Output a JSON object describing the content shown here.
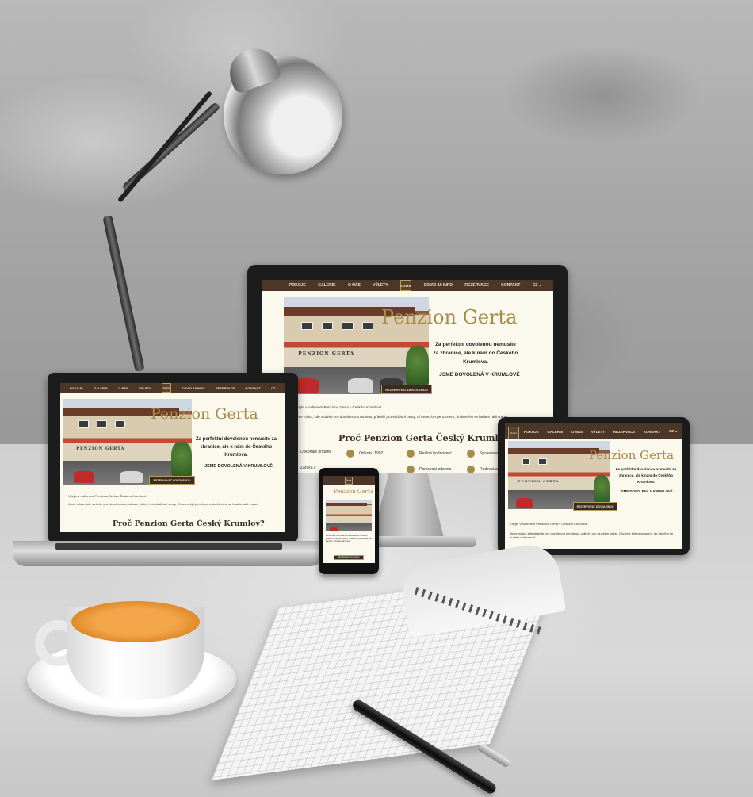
{
  "site": {
    "nav": [
      "POKOJE",
      "GALERIE",
      "O NÁS",
      "VÝLETY",
      "COVID-19 INFO",
      "REZERVACE",
      "KONTAKT"
    ],
    "nav_short": [
      "POKOJE",
      "GALERIE",
      "O NÁS",
      "VÝLETY",
      "REZERVACE",
      "KONTAKT"
    ],
    "lang": "CZ ⌄",
    "logo_text": "Gerta",
    "title": "Penzion Gerta",
    "tagline": "Za perfektní dovolenou nemusíte za zhranice, ale k nám do Českého Krumlova.",
    "subtitle": "JSME DOVOLENÁ V KRUMLOVĚ",
    "cta": "REZERVOVAT DOVOLENOU",
    "sign": "PENZION GERTA",
    "intro": "Vítejte v rodinném Penzionu Gerta v Českém Krumlově.",
    "body": "Jsme místo, kde strávíte pro dovolenou s rodinou, přáteli i pro služební cesty. Chceme být penzionem, do kterého se budete rádi vracet.",
    "section_title": "Proč Penzion Gerta Český Krumlov?",
    "features": [
      "Dokonalé přidané",
      "Od roku 1992",
      "Reálná hodnocení",
      "Společenská",
      "Záruka s",
      "Parkovací zdarma",
      "Rodinná am"
    ]
  },
  "colors": {
    "nav_bg": "#4b3628",
    "accent_gold": "#a88b46",
    "page_bg": "#fbf8ee"
  },
  "icons": [
    "desk-lamp-icon",
    "coffee-cup-icon",
    "notebook-icon",
    "pen-icon"
  ]
}
